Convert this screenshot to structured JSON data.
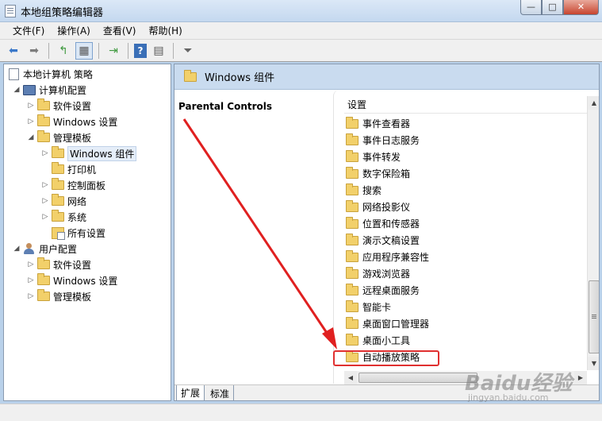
{
  "window": {
    "title": "本地组策略编辑器",
    "buttons": {
      "minimize": "—",
      "maximize": "□",
      "close": "✕"
    }
  },
  "menu": [
    "文件(F)",
    "操作(A)",
    "查看(V)",
    "帮助(H)"
  ],
  "toolbar": {
    "icons": [
      "back-arrow-icon",
      "forward-arrow-icon",
      "up-folder-icon",
      "show-hide-tree-icon",
      "export-list-icon",
      "help-icon",
      "properties-icon",
      "filter-icon"
    ],
    "glyphs": {
      "back": "⬅",
      "forward": "➡",
      "up": "↰",
      "tree": "▦",
      "export": "⇥",
      "help": "?",
      "props": "▤",
      "filter": "⏷"
    }
  },
  "tree": {
    "root": "本地计算机 策略",
    "computer_config": "计算机配置",
    "software_settings": "软件设置",
    "windows_settings": "Windows 设置",
    "admin_templates": "管理模板",
    "windows_components": "Windows 组件",
    "printers": "打印机",
    "control_panel": "控制面板",
    "network": "网络",
    "system": "系统",
    "all_settings": "所有设置",
    "user_config": "用户配置",
    "user_software_settings": "软件设置",
    "user_windows_settings": "Windows 设置",
    "user_admin_templates": "管理模板"
  },
  "right_pane": {
    "header": "Windows 组件",
    "extended_title": "Parental Controls",
    "column_header": "设置",
    "items": [
      "事件查看器",
      "事件日志服务",
      "事件转发",
      "数字保险箱",
      "搜索",
      "网络投影仪",
      "位置和传感器",
      "演示文稿设置",
      "应用程序兼容性",
      "游戏浏览器",
      "远程桌面服务",
      "智能卡",
      "桌面窗口管理器",
      "桌面小工具",
      "自动播放策略"
    ],
    "highlighted_item": "自动播放策略"
  },
  "tabs": {
    "extended": "扩展",
    "standard": "标准"
  },
  "annotation": {
    "arrow_color": "#e02020",
    "box_color": "#e03030"
  },
  "watermark": {
    "brand": "Baidu经验",
    "url": "jingyan.baidu.com"
  }
}
